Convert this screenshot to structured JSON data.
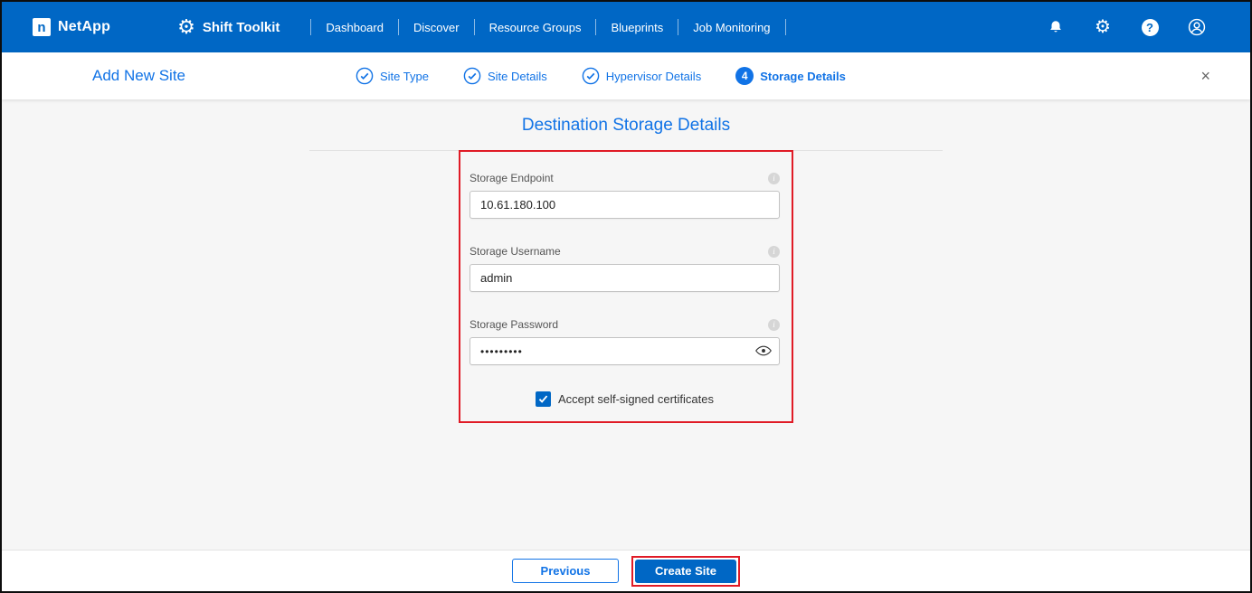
{
  "topnav": {
    "brand": "NetApp",
    "app_title": "Shift Toolkit",
    "items": [
      {
        "label": "Dashboard"
      },
      {
        "label": "Discover"
      },
      {
        "label": "Resource Groups"
      },
      {
        "label": "Blueprints"
      },
      {
        "label": "Job Monitoring"
      }
    ]
  },
  "wizard": {
    "title": "Add New Site",
    "steps": [
      {
        "label": "Site Type",
        "state": "done"
      },
      {
        "label": "Site Details",
        "state": "done"
      },
      {
        "label": "Hypervisor Details",
        "state": "done"
      },
      {
        "label": "Storage Details",
        "state": "active",
        "number": "4"
      }
    ]
  },
  "form": {
    "title": "Destination Storage Details",
    "fields": [
      {
        "label": "Storage Endpoint",
        "value": "10.61.180.100"
      },
      {
        "label": "Storage Username",
        "value": "admin"
      },
      {
        "label": "Storage Password",
        "value": "•••••••••"
      }
    ],
    "checkbox_label": "Accept self-signed certificates",
    "checkbox_checked": true
  },
  "footer": {
    "previous_label": "Previous",
    "create_label": "Create Site"
  },
  "icons": {
    "logo_glyph": "n",
    "gear_glyph": "⚙",
    "help_glyph": "?",
    "info_glyph": "i",
    "close_glyph": "×"
  },
  "colors": {
    "brand_blue": "#0067C5",
    "accent_blue": "#1173E6",
    "annotation_red": "#E01B26",
    "content_background": "#f6f6f6"
  }
}
